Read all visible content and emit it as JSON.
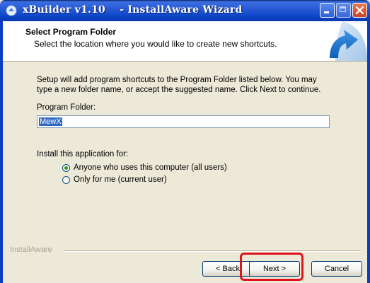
{
  "window": {
    "title": "xBuilder v1.10    - InstallAware Wizard"
  },
  "header": {
    "title": "Select Program Folder",
    "subtitle": "Select the location where you would like to create new shortcuts."
  },
  "body": {
    "description": "Setup will add program shortcuts to the Program Folder listed below. You may type a new folder name, or accept the suggested name. Click Next to continue.",
    "program_folder_label": "Program Folder:",
    "program_folder_value": "MewX",
    "install_for_label": "Install this application for:",
    "options": [
      {
        "label": "Anyone who uses this computer (all users)",
        "selected": true
      },
      {
        "label": "Only for me (current user)",
        "selected": false
      }
    ]
  },
  "footer": {
    "brand": "InstallAware",
    "back_label": "< Back",
    "next_label": "Next >",
    "cancel_label": "Cancel"
  },
  "annotation": {
    "highlight_color": "#e0141d"
  }
}
